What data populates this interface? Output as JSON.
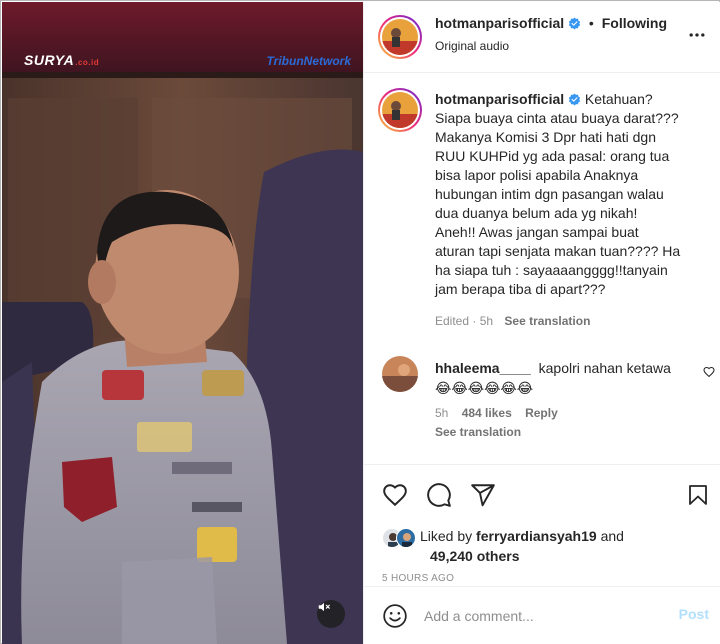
{
  "post": {
    "username": "hotmanparisofficial",
    "following_label": "Following",
    "audio_label": "Original audio",
    "caption": "Ketahuan?\nSiapa buaya cinta atau buaya darat???\nMakanya Komisi 3 Dpr hati hati dgn\nRUU KUHPid yg ada pasal: orang tua\nbisa lapor polisi apabila Anaknya\nhubungan intim dgn pasangan walau\ndua duanya belum ada yg nikah!\nAneh!! Awas jangan sampai buat\naturan tapi senjata makan tuan???? Ha\nha siapa tuh : sayaaaangggg!!tanyain\njam berapa tiba di apart???",
    "caption_meta": "Edited · 5h",
    "see_translation": "See translation"
  },
  "video": {
    "logo_left": "SURYA",
    "logo_left_sub": ".co.id",
    "logo_right": "TribunNetwork"
  },
  "reply": {
    "username": "hhaleema____",
    "text": "kapolri nahan ketawa",
    "emojis": "😂😂😂😂😂😂",
    "age": "5h",
    "likes": "484 likes",
    "reply_label": "Reply",
    "see_translation": "See translation"
  },
  "engagement": {
    "liked_by_prefix": "Liked by",
    "liked_by_user": "ferryardiansyah19",
    "and_label": "and",
    "others": "49,240 others",
    "timestamp": "5 HOURS AGO"
  },
  "composer": {
    "placeholder": "Add a comment...",
    "post_label": "Post"
  },
  "colors": {
    "verified": "#3897f0",
    "post_disabled": "#b2dffc",
    "muted_text": "#8e8e8e"
  },
  "icons": [
    "verified-badge-icon",
    "more-options-icon",
    "heart-icon",
    "comment-icon",
    "share-icon",
    "save-icon",
    "emoji-icon",
    "volume-mute-icon",
    "small-heart-icon"
  ]
}
